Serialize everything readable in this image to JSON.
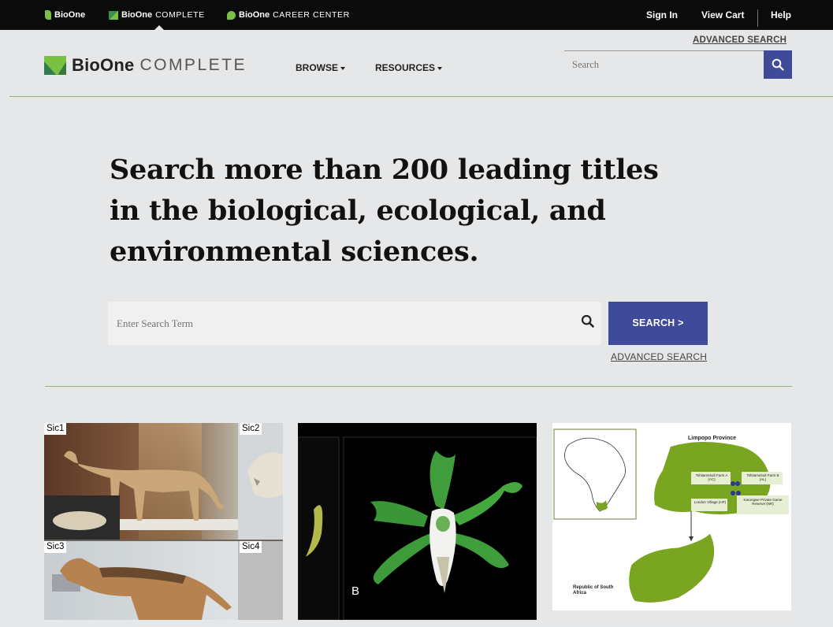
{
  "topbar": {
    "sites": [
      {
        "bold": "BioOne",
        "light": ""
      },
      {
        "bold": "BioOne",
        "light": "COMPLETE"
      },
      {
        "bold": "BioOne",
        "light": "CAREER CENTER"
      }
    ],
    "links": {
      "sign_in": "Sign In",
      "view_cart": "View Cart",
      "help": "Help"
    }
  },
  "header": {
    "advanced_search": "ADVANCED SEARCH",
    "logo_bold": "BioOne",
    "logo_light": "COMPLETE",
    "nav": {
      "browse": "BROWSE",
      "resources": "RESOURCES"
    },
    "search_placeholder": "Search"
  },
  "hero": {
    "title": "Search more than 200 leading titles in the biological, ecological, and environmental sciences.",
    "search_placeholder": "Enter Search Term",
    "search_button": "SEARCH >",
    "advanced_search": "ADVANCED SEARCH"
  },
  "cards": {
    "card1": {
      "labels": [
        "Sic1",
        "Sic2",
        "Sic3",
        "Sic4"
      ]
    },
    "card2": {
      "label": "B"
    },
    "card3": {
      "region": "Limpopo Province",
      "country": "Republic of South Africa",
      "places": [
        "Tshitamelodi Farm A (AC)",
        "Tshitamelodi Farm B (AL)",
        "London Village (HP)",
        "Karongwe Private Game Reserve (NR)"
      ]
    }
  },
  "colors": {
    "accent": "#3f4a9a",
    "green": "#7ac143",
    "rule": "#8cb96c",
    "topbar": "#0b0b0b"
  }
}
